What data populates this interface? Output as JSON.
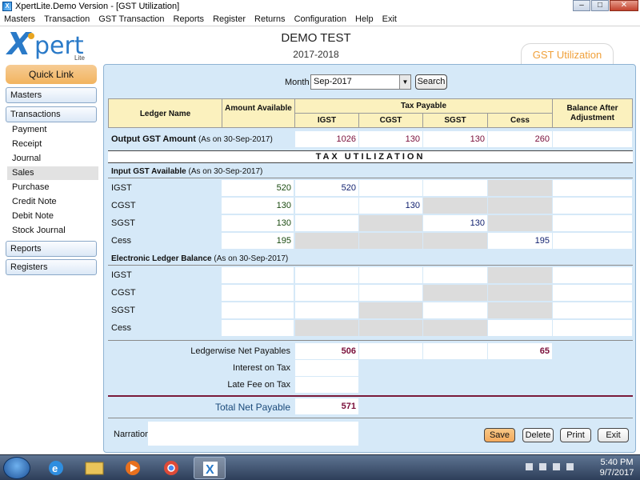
{
  "window": {
    "title": "XpertLite.Demo Version - [GST Utilization]"
  },
  "menu": [
    "Masters",
    "Transaction",
    "GST Transaction",
    "Reports",
    "Register",
    "Returns",
    "Configuration",
    "Help",
    "Exit"
  ],
  "logo": {
    "x": "X",
    "text": "pert",
    "sub": "Lite"
  },
  "header": {
    "company": "DEMO TEST",
    "year": "2017-2018",
    "tab": "GST Utilization"
  },
  "sidebar": {
    "quick_link": "Quick Link",
    "masters": "Masters",
    "transactions": "Transactions",
    "items": [
      "Payment",
      "Receipt",
      "Journal",
      "Sales",
      "Purchase",
      "Credit Note",
      "Debit Note",
      "Stock Journal"
    ],
    "selected": "Sales",
    "reports": "Reports",
    "registers": "Registers"
  },
  "filter": {
    "month_label": "Month",
    "month_value": "Sep-2017",
    "search_label": "Search"
  },
  "table_header": {
    "ledger": "Ledger Name",
    "amount": "Amount Available",
    "tax_payable": "Tax Payable",
    "igst": "IGST",
    "cgst": "CGST",
    "sgst": "SGST",
    "cess": "Cess",
    "balance": "Balance After Adjustment"
  },
  "output": {
    "label": "Output GST Amount",
    "asof": "(As on 30-Sep-2017)",
    "igst": "1026",
    "cgst": "130",
    "sgst": "130",
    "cess": "260"
  },
  "tax_utilization": "TAX UTILIZATION",
  "input": {
    "label": "Input GST Available",
    "asof": "(As on 30-Sep-2017)",
    "rows": [
      {
        "name": "IGST",
        "amount": "520",
        "igst": "520",
        "cgst": "",
        "sgst": "",
        "cess": ""
      },
      {
        "name": "CGST",
        "amount": "130",
        "igst": "",
        "cgst": "130",
        "sgst": "",
        "cess": ""
      },
      {
        "name": "SGST",
        "amount": "130",
        "igst": "",
        "cgst": "",
        "sgst": "130",
        "cess": ""
      },
      {
        "name": "Cess",
        "amount": "195",
        "igst": "",
        "cgst": "",
        "sgst": "",
        "cess": "195"
      }
    ]
  },
  "electronic": {
    "label": "Electronic Ledger Balance",
    "asof": "(As on 30-Sep-2017)",
    "rows": [
      "IGST",
      "CGST",
      "SGST",
      "Cess"
    ]
  },
  "net": {
    "ledgerwise_label": "Ledgerwise Net Payables",
    "ledgerwise_igst": "506",
    "ledgerwise_cess": "65",
    "interest_label": "Interest on Tax",
    "latefee_label": "Late Fee on Tax",
    "total_label": "Total Net Payable",
    "total_value": "571"
  },
  "narration": {
    "label": "Narration",
    "value": ""
  },
  "buttons": {
    "save": "Save",
    "delete": "Delete",
    "print": "Print",
    "exit": "Exit"
  },
  "clock": {
    "time": "5:40 PM",
    "date": "9/7/2017"
  },
  "colors": {
    "accent": "#f0a03a",
    "panel": "#d6e9f8",
    "header_yellow": "#fbf1be",
    "value_red": "#7a0f3a",
    "value_blue": "#0f1f6e"
  }
}
